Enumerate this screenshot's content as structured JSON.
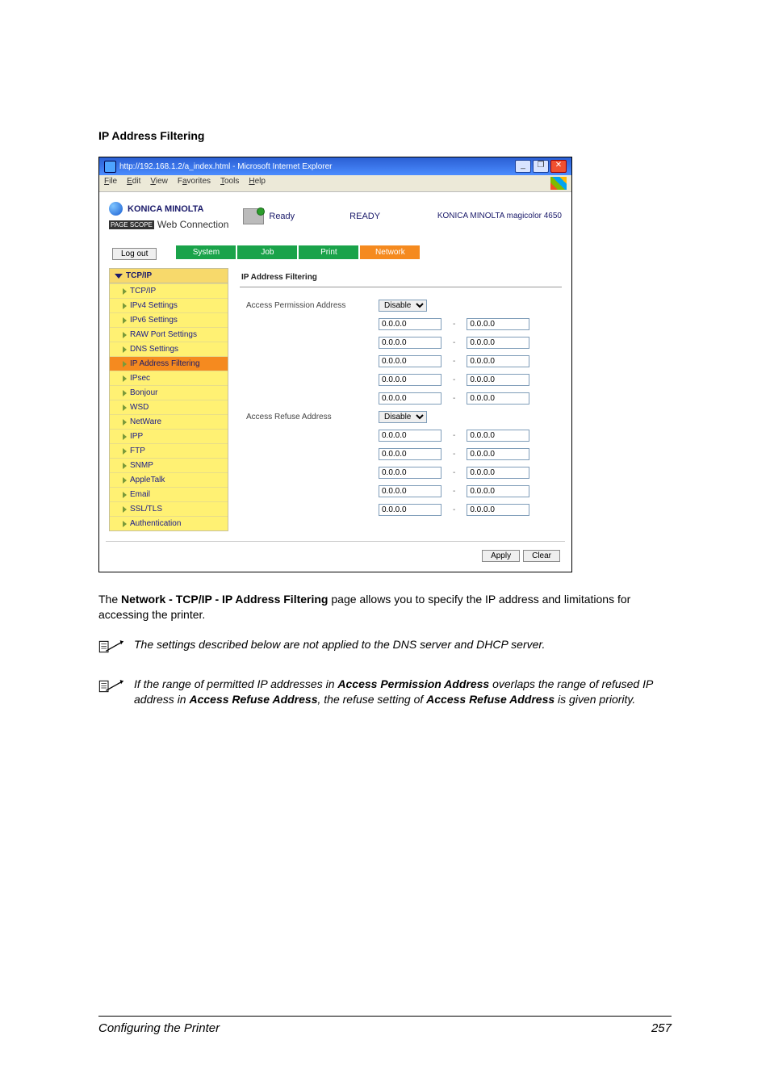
{
  "heading": "IP Address Filtering",
  "browser": {
    "title": "http://192.168.1.2/a_index.html - Microsoft Internet Explorer",
    "menus": [
      "File",
      "Edit",
      "View",
      "Favorites",
      "Tools",
      "Help"
    ],
    "window_buttons": {
      "min": "_",
      "max": "❐",
      "close": "✕"
    }
  },
  "brand": {
    "name": "KONICA MINOLTA",
    "tag_prefix": "PAGE SCOPE",
    "tag_suffix": "Web Connection"
  },
  "status": {
    "label": "Ready",
    "banner": "READY"
  },
  "model": "KONICA MINOLTA magicolor 4650",
  "logout": "Log out",
  "tabs": [
    "System",
    "Job",
    "Print",
    "Network"
  ],
  "sidebar": {
    "head": "TCP/IP",
    "items": [
      {
        "label": "TCP/IP",
        "selected": false
      },
      {
        "label": "IPv4 Settings",
        "selected": false
      },
      {
        "label": "IPv6 Settings",
        "selected": false
      },
      {
        "label": "RAW Port Settings",
        "selected": false
      },
      {
        "label": "DNS Settings",
        "selected": false
      },
      {
        "label": "IP Address Filtering",
        "selected": true
      },
      {
        "label": "IPsec",
        "selected": false
      }
    ],
    "extra": [
      "Bonjour",
      "WSD",
      "NetWare",
      "IPP",
      "FTP",
      "SNMP",
      "AppleTalk",
      "Email",
      "SSL/TLS",
      "Authentication"
    ]
  },
  "main": {
    "title": "IP Address Filtering",
    "permission_label": "Access Permission Address",
    "refuse_label": "Access Refuse Address",
    "permission_select": "Disable",
    "refuse_select": "Disable",
    "rows_permission": [
      {
        "from": "0.0.0.0",
        "to": "0.0.0.0"
      },
      {
        "from": "0.0.0.0",
        "to": "0.0.0.0"
      },
      {
        "from": "0.0.0.0",
        "to": "0.0.0.0"
      },
      {
        "from": "0.0.0.0",
        "to": "0.0.0.0"
      },
      {
        "from": "0.0.0.0",
        "to": "0.0.0.0"
      }
    ],
    "rows_refuse": [
      {
        "from": "0.0.0.0",
        "to": "0.0.0.0"
      },
      {
        "from": "0.0.0.0",
        "to": "0.0.0.0"
      },
      {
        "from": "0.0.0.0",
        "to": "0.0.0.0"
      },
      {
        "from": "0.0.0.0",
        "to": "0.0.0.0"
      },
      {
        "from": "0.0.0.0",
        "to": "0.0.0.0"
      }
    ],
    "sep": "-",
    "apply": "Apply",
    "clear": "Clear"
  },
  "body": {
    "para1a": "The ",
    "para1b": "Network - TCP/IP - IP Address Filtering",
    "para1c": " page allows you to specify the IP address and limitations for accessing the printer.",
    "note1": "The settings described below are not applied to the DNS server and DHCP server.",
    "note2a": "If the range of permitted IP addresses in ",
    "note2b": "Access Permission Address",
    "note2c": " overlaps the range of refused IP address in ",
    "note2d": "Access Refuse Address",
    "note2e": ", the refuse setting of ",
    "note2f": "Access Refuse Address",
    "note2g": " is given priority."
  },
  "footer": {
    "left": "Configuring the Printer",
    "right": "257"
  }
}
